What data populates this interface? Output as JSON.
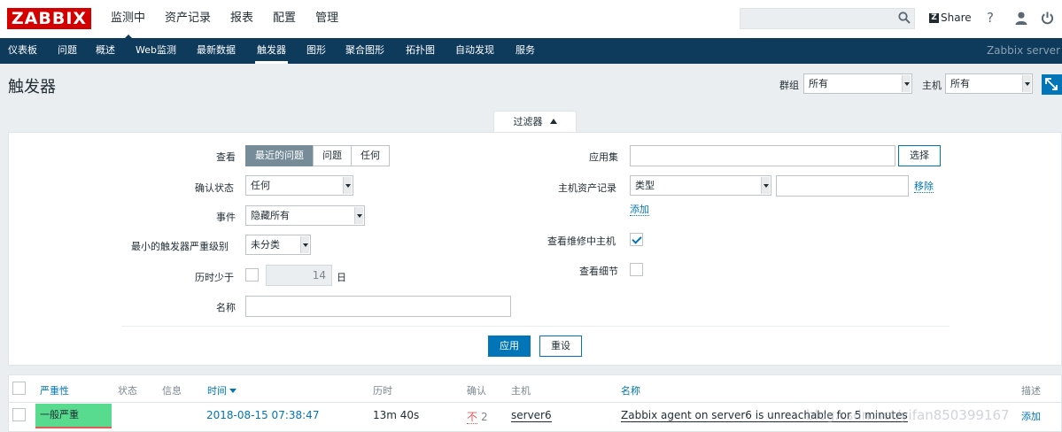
{
  "app": {
    "logo": "ZABBIX",
    "main_menu": [
      "监测中",
      "资产记录",
      "报表",
      "配置",
      "管理"
    ],
    "share_label": "Share",
    "help_label": "?"
  },
  "subnav": {
    "items": [
      "仪表板",
      "问题",
      "概述",
      "Web监测",
      "最新数据",
      "触发器",
      "图形",
      "聚合图形",
      "拓扑图",
      "自动发现",
      "服务"
    ],
    "server": "Zabbix server"
  },
  "page": {
    "title": "触发器",
    "group_label": "群组",
    "group_value": "所有",
    "host_label": "主机",
    "host_value": "所有"
  },
  "filter": {
    "tab_label": "过滤器",
    "show_label": "查看",
    "show_options": [
      "最近的问题",
      "问题",
      "任何"
    ],
    "ack_label": "确认状态",
    "ack_value": "任何",
    "events_label": "事件",
    "events_value": "隐藏所有",
    "min_sev_label": "最小的触发器严重级别",
    "min_sev_value": "未分类",
    "age_label": "历时少于",
    "age_value": "14",
    "age_unit": "日",
    "name_label": "名称",
    "app_label": "应用集",
    "select_button": "选择",
    "inventory_label": "主机资产记录",
    "inventory_type": "类型",
    "remove_link": "移除",
    "add_link": "添加",
    "maintenance_label": "查看维修中主机",
    "details_label": "查看细节",
    "apply_button": "应用",
    "reset_button": "重设"
  },
  "table": {
    "headers": {
      "severity": "严重性",
      "status": "状态",
      "info": "信息",
      "time": "时间",
      "age": "历时",
      "ack": "确认",
      "host": "主机",
      "name": "名称",
      "desc": "描述"
    },
    "rows": [
      {
        "severity": "一般严重",
        "time": "2018-08-15 07:38:47",
        "age": "13m 40s",
        "ack": "不",
        "ack_count": "2",
        "host": "server6",
        "name": "Zabbix agent on server6 is unreachable for 5 minutes",
        "desc": "添加"
      }
    ]
  },
  "watermark": "blog.csdn.net/yifan850399167",
  "colors": {
    "brand": "#d40000",
    "nav": "#0e3a5c",
    "accent": "#0275b8",
    "severity_average": "#59db8f"
  }
}
